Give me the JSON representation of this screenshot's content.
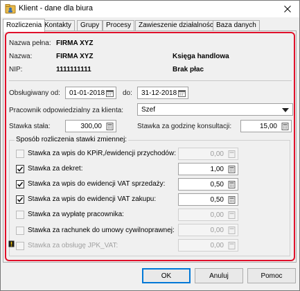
{
  "window": {
    "title": "Klient - dane dla biura"
  },
  "tabs": [
    {
      "label": "Rozliczenia"
    },
    {
      "label": "Kontakty"
    },
    {
      "label": "Grupy"
    },
    {
      "label": "Procesy"
    },
    {
      "label": "Zawieszenie działalności"
    },
    {
      "label": "Baza danych"
    }
  ],
  "client": {
    "full_name_label": "Nazwa pełna:",
    "full_name": "FIRMA XYZ",
    "name_label": "Nazwa:",
    "name": "FIRMA XYZ",
    "nip_label": "NIP:",
    "nip": "1111111111",
    "book_type": "Księga handlowa",
    "payroll": "Brak płac"
  },
  "service": {
    "from_label": "Obsługiwany od:",
    "from_value": "01-01-2018",
    "to_label": "do:",
    "to_value": "31-12-2018",
    "employee_label": "Pracownik odpowiedzialny za klienta:",
    "employee_value": "Szef",
    "fixed_rate_label": "Stawka stała:",
    "fixed_rate_value": "300,00",
    "hourly_rate_label": "Stawka za godzinę konsultacji:",
    "hourly_rate_value": "15,00"
  },
  "variable": {
    "title": "Sposób rozliczenia stawki zmiennej:",
    "rows": [
      {
        "label": "Stawka za wpis do KPiR,/ewidencji przychodów:",
        "value": "0,00",
        "checked": false,
        "enabled": false
      },
      {
        "label": "Stawka za dekret:",
        "value": "1,00",
        "checked": true,
        "enabled": true
      },
      {
        "label": "Stawka za wpis do ewidencji VAT sprzedaży:",
        "value": "0,50",
        "checked": true,
        "enabled": true
      },
      {
        "label": "Stawka za wpis do ewidencji VAT zakupu:",
        "value": "0,50",
        "checked": true,
        "enabled": true
      },
      {
        "label": "Stawka za wypłatę pracownika:",
        "value": "0,00",
        "checked": false,
        "enabled": false
      },
      {
        "label": "Stawka za rachunek do umowy cywilnoprawnej:",
        "value": "0,00",
        "checked": false,
        "enabled": false
      },
      {
        "label": "Stawka za obsługę JPK_VAT:",
        "value": "0,00",
        "checked": false,
        "enabled": false
      }
    ]
  },
  "buttons": {
    "ok": "OK",
    "cancel": "Anuluj",
    "help": "Pomoc"
  },
  "colors": {
    "highlight": "#e0102a",
    "accent": "#0078d7"
  }
}
